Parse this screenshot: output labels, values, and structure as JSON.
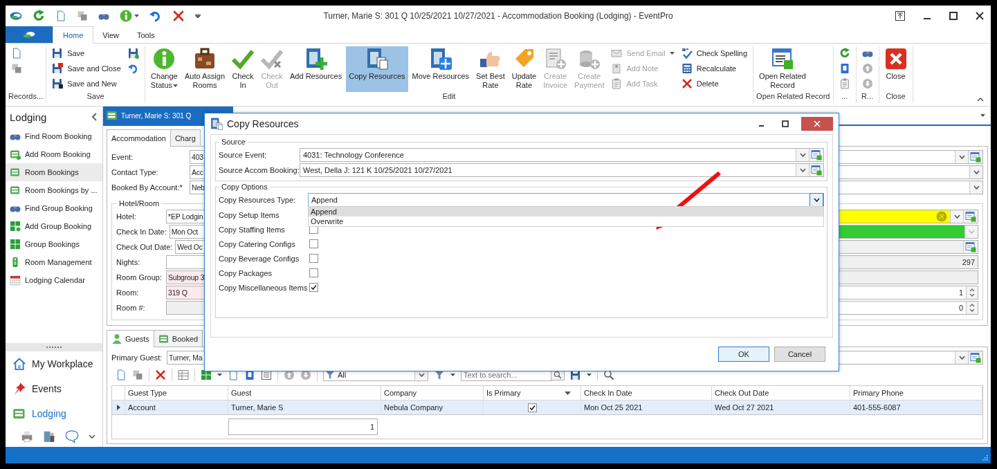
{
  "window": {
    "title": "Turner, Marie S: 301 Q 10/25/2021 10/27/2021  - Accommodation Booking (Lodging) - EventPro"
  },
  "ribbon": {
    "tabs": [
      {
        "label": "Home",
        "selected": true
      },
      {
        "label": "View",
        "selected": false
      },
      {
        "label": "Tools",
        "selected": false
      }
    ],
    "groups": [
      {
        "label": "Records...",
        "items": [
          {
            "kind": "small"
          },
          {
            "kind": "small"
          }
        ]
      },
      {
        "label": "Save",
        "items": [
          {
            "kind": "small",
            "label": "Save"
          },
          {
            "kind": "small",
            "label": "Save and Close"
          },
          {
            "kind": "small",
            "label": "Save and New"
          },
          {
            "kind": "small"
          },
          {
            "kind": "small"
          }
        ]
      },
      {
        "label": "Edit",
        "items": [
          {
            "kind": "large",
            "label": "Change\nStatus",
            "dropdown": true
          },
          {
            "kind": "large",
            "label": "Auto Assign\nRooms"
          },
          {
            "kind": "large",
            "label": "Check\nIn"
          },
          {
            "kind": "large",
            "label": "Check\nOut",
            "disabled": true
          },
          {
            "kind": "large",
            "label": "Add Resources"
          },
          {
            "kind": "large",
            "label": "Copy Resources",
            "selected": true
          },
          {
            "kind": "large",
            "label": "Move Resources"
          },
          {
            "kind": "large",
            "label": "Set Best\nRate"
          },
          {
            "kind": "large",
            "label": "Update\nRate"
          },
          {
            "kind": "large",
            "label": "Create\nInvoice",
            "disabled": true
          },
          {
            "kind": "large",
            "label": "Create\nPayment",
            "disabled": true
          },
          {
            "kind": "small",
            "label": "Send Email",
            "disabled": true,
            "dropdown": true
          },
          {
            "kind": "small",
            "label": "Add Note",
            "disabled": true
          },
          {
            "kind": "small",
            "label": "Add Task",
            "disabled": true
          },
          {
            "kind": "small",
            "label": "Check Spelling"
          },
          {
            "kind": "small",
            "label": "Recalculate"
          },
          {
            "kind": "small",
            "label": "Delete"
          }
        ]
      },
      {
        "label": "Open Related Record",
        "items": [
          {
            "kind": "large",
            "label": "Open Related\nRecord"
          }
        ]
      },
      {
        "label": "...",
        "items": [
          {
            "kind": "small"
          },
          {
            "kind": "small"
          },
          {
            "kind": "small"
          }
        ]
      },
      {
        "label": "R...",
        "items": [
          {
            "kind": "small"
          },
          {
            "kind": "small"
          },
          {
            "kind": "small"
          }
        ]
      },
      {
        "label": "Close",
        "items": [
          {
            "kind": "large",
            "label": "Close"
          }
        ]
      }
    ]
  },
  "sidebar": {
    "title": "Lodging",
    "items": [
      {
        "label": "Find Room Booking",
        "selected": false
      },
      {
        "label": "Add Room Booking",
        "selected": false
      },
      {
        "label": "Room Bookings",
        "selected": true
      },
      {
        "label": "Room Bookings by ...",
        "selected": false
      },
      {
        "label": "Find Group Booking",
        "selected": false
      },
      {
        "label": "Add Group Booking",
        "selected": false
      },
      {
        "label": "Group Bookings",
        "selected": false
      },
      {
        "label": "Room Management",
        "selected": false
      },
      {
        "label": "Lodging Calendar",
        "selected": false
      }
    ],
    "nav": [
      {
        "label": "My Workplace",
        "selected": false
      },
      {
        "label": "Events",
        "selected": false
      },
      {
        "label": "Lodging",
        "selected": true
      }
    ]
  },
  "document_tab": {
    "label": "Turner, Marie S: 301 Q"
  },
  "form": {
    "tabs": [
      {
        "label": "Accommodation",
        "selected": true
      },
      {
        "label": "Charg",
        "selected": false
      }
    ],
    "fields": [
      {
        "label": "Event:",
        "value": "403",
        "lookup": true
      },
      {
        "label": "Contact Type:",
        "value": "Acc",
        "lookup": false
      },
      {
        "label": "Booked By Account:*",
        "value": "Neb",
        "lookup": false
      }
    ],
    "hotel_room": {
      "title": "Hotel/Room",
      "rows": [
        {
          "label": "Hotel:",
          "value": "*EP Lodgin",
          "color": "#ffffff",
          "side": {
            "color": "#ffff00",
            "buttons": [
              {
                "kind": "clear"
              },
              {
                "kind": "dropdown",
                "disabled": false
              },
              {
                "kind": "lookup"
              }
            ]
          }
        },
        {
          "label": "Check In Date:",
          "value": "Mon Oct",
          "color": "#ffffff",
          "side": {
            "color": "#33cc33",
            "buttons": [
              {
                "kind": "dropdown",
                "disabled": true
              }
            ]
          }
        },
        {
          "label": "Check Out Date:",
          "value": "Wed Oc",
          "color": "#ffffff",
          "side": {
            "color": "#f0f0f0",
            "buttons": [
              {
                "kind": "lookup"
              }
            ]
          }
        },
        {
          "label": "Nights:",
          "color": "#ffffff",
          "side": {
            "color": "#f0f0f0",
            "value": "297"
          }
        },
        {
          "label": "Room Group:",
          "value": "Subgroup 3",
          "color": "#fde9ee",
          "side": {
            "color": "#f0f0f0"
          }
        },
        {
          "label": "Room:",
          "value": "319 Q",
          "color": "#fde9ee",
          "side": {
            "color": "#ffffff",
            "value": "1",
            "buttons": [
              {
                "kind": "spin"
              }
            ]
          }
        },
        {
          "label": "Room #:",
          "color": "#f0f0f0",
          "side": {
            "color": "#ffffff",
            "value": "0",
            "buttons": [
              {
                "kind": "spin"
              }
            ]
          }
        }
      ]
    }
  },
  "guests": {
    "tabs": [
      {
        "label": "Guests",
        "selected": true
      },
      {
        "label": "Booked",
        "selected": false
      }
    ],
    "primary_guest": {
      "label": "Primary Guest:",
      "value": "Turner, Ma"
    },
    "filter": "All",
    "search_placeholder": "Text to search...",
    "columns": [
      {
        "label": "Guest Type"
      },
      {
        "label": "Guest"
      },
      {
        "label": "Company"
      },
      {
        "label": "Is Primary",
        "filter_button": true
      },
      {
        "label": "Check In Date"
      },
      {
        "label": "Check Out Date"
      },
      {
        "label": "Primary Phone"
      }
    ],
    "rows": [
      {
        "guest_type": "Account",
        "guest": "Turner, Marie S",
        "company": "Nebula Company",
        "is_primary": true,
        "check_in": "Mon Oct 25 2021",
        "check_out": "Wed Oct 27 2021",
        "phone": "401-555-6087",
        "selected": true
      }
    ],
    "count": "1"
  },
  "dialog": {
    "title": "Copy Resources",
    "source": {
      "title": "Source",
      "fields": [
        {
          "label": "Source Event:",
          "value": "4031: Technology Conference"
        },
        {
          "label": "Source Accom Booking:",
          "value": "West, Della J: 121 K 10/25/2021 10/27/2021"
        }
      ]
    },
    "options": {
      "title": "Copy Options",
      "type_label": "Copy Resources Type:",
      "type_value": "Append",
      "expanded": true,
      "dropdown_items": [
        {
          "label": "Append",
          "selected": true
        },
        {
          "label": "Overwrite",
          "selected": false
        }
      ],
      "checks": [
        {
          "label": "Copy Setup Items"
        },
        {
          "label": "Copy Staffing Items",
          "checked": false
        },
        {
          "label": "Copy Catering Configs",
          "checked": false
        },
        {
          "label": "Copy Beverage Configs",
          "checked": false
        },
        {
          "label": "Copy Packages",
          "checked": false
        },
        {
          "label": "Copy Miscellaneous Items",
          "checked": true
        }
      ]
    },
    "buttons": [
      {
        "label": "OK",
        "default": true
      },
      {
        "label": "Cancel",
        "default": false
      }
    ]
  }
}
